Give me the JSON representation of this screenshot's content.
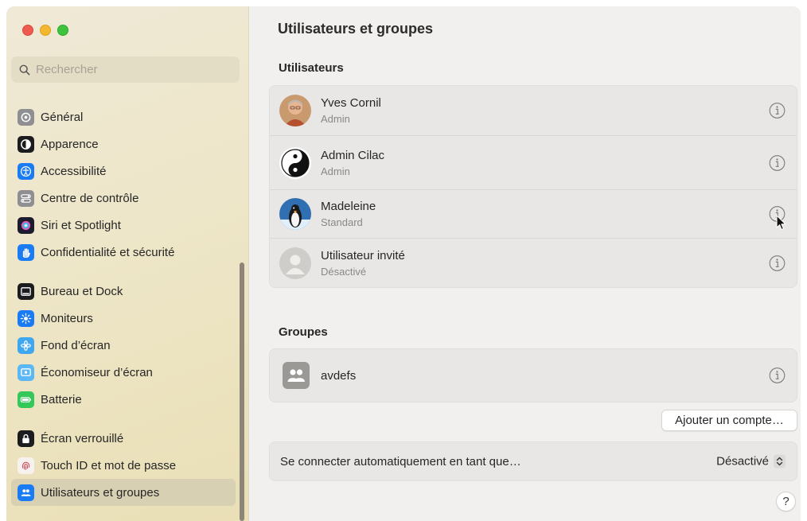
{
  "window": {
    "title": "Utilisateurs et groupes"
  },
  "search": {
    "placeholder": "Rechercher"
  },
  "sidebar": {
    "groups": [
      [
        {
          "label": "Général",
          "icon": "gear-icon",
          "color": "#8e8e93"
        },
        {
          "label": "Apparence",
          "icon": "appearance-icon",
          "color": "#1c1c1e"
        },
        {
          "label": "Accessibilité",
          "icon": "accessibility-icon",
          "color": "#1a7cf4"
        },
        {
          "label": "Centre de contrôle",
          "icon": "control-center-icon",
          "color": "#8e8e93"
        },
        {
          "label": "Siri et Spotlight",
          "icon": "siri-icon",
          "color": "#5b3fc4"
        },
        {
          "label": "Confidentialité et sécurité",
          "icon": "hand-icon",
          "color": "#1a7cf4"
        }
      ],
      [
        {
          "label": "Bureau et Dock",
          "icon": "dock-icon",
          "color": "#1c1c1e"
        },
        {
          "label": "Moniteurs",
          "icon": "brightness-icon",
          "color": "#1a7cf4"
        },
        {
          "label": "Fond d’écran",
          "icon": "wallpaper-icon",
          "color": "#3fa7f0"
        },
        {
          "label": "Économiseur d’écran",
          "icon": "screensaver-icon",
          "color": "#5bb8f5"
        },
        {
          "label": "Batterie",
          "icon": "battery-icon",
          "color": "#34c759"
        }
      ],
      [
        {
          "label": "Écran verrouillé",
          "icon": "lock-icon",
          "color": "#1c1c1e"
        },
        {
          "label": "Touch ID et mot de passe",
          "icon": "fingerprint-icon",
          "color": "#f2a7b0"
        },
        {
          "label": "Utilisateurs et groupes",
          "icon": "users-icon",
          "color": "#1a7cf4",
          "selected": true
        }
      ]
    ]
  },
  "main": {
    "title": "Utilisateurs et groupes",
    "users_title": "Utilisateurs",
    "users": [
      {
        "name": "Yves Cornil",
        "role": "Admin",
        "avatar": "photo-avatar"
      },
      {
        "name": "Admin Cilac",
        "role": "Admin",
        "avatar": "yin-yang-avatar"
      },
      {
        "name": "Madeleine",
        "role": "Standard",
        "avatar": "penguin-avatar"
      },
      {
        "name": "Utilisateur invité",
        "role": "Désactivé",
        "avatar": "guest-avatar"
      }
    ],
    "groups_title": "Groupes",
    "groups": [
      {
        "name": "avdefs",
        "icon": "group-icon"
      }
    ],
    "add_account_label": "Ajouter un compte…",
    "auto_login": {
      "label": "Se connecter automatiquement en tant que…",
      "value": "Désactivé"
    },
    "help_label": "?"
  },
  "colors": {
    "accent": "#1a7cf4",
    "sidebar_selected": "#d8d0b3"
  }
}
